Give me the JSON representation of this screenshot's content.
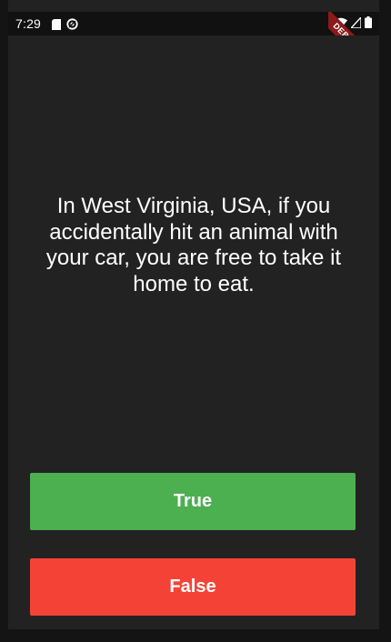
{
  "status_bar": {
    "time": "7:29",
    "left_icons": [
      "sd-card-icon",
      "sync-icon"
    ],
    "right_icons": [
      "wifi-icon",
      "signal-icon",
      "battery-icon"
    ]
  },
  "debug_banner": {
    "label": "DEBUG"
  },
  "quiz": {
    "question": "In West Virginia, USA, if you accidentally hit an animal with your car, you are free to take it home to eat.",
    "true_label": "True",
    "false_label": "False"
  },
  "colors": {
    "background": "#222222",
    "true_button": "#4caf50",
    "false_button": "#f44336",
    "text": "#ffffff",
    "debug_ribbon": "#8b1a1a"
  }
}
